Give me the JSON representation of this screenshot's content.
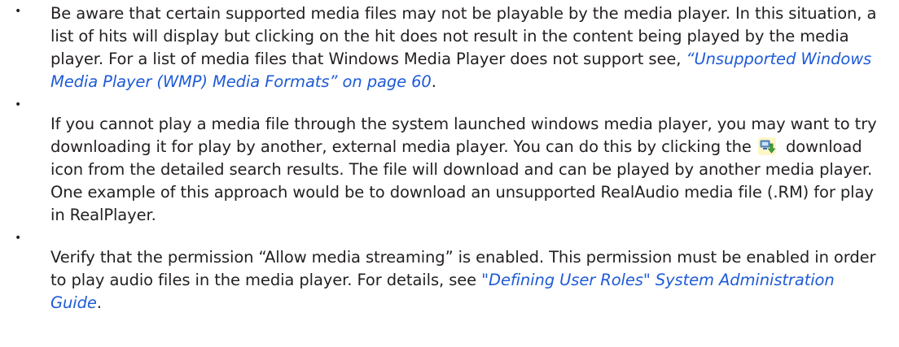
{
  "bullets": [
    {
      "marker": "•",
      "text_before": "Be aware that certain supported media files may not be playable by the media player. In this situation, a list of hits will display but clicking on the hit does not result in the content being played by the media player. For a list of media files that Windows Media Player does not support see, ",
      "link": "“Unsupported Windows Media Player (WMP) Media Formats” on page 60",
      "text_after": "."
    },
    {
      "marker": "•",
      "text_before": "If you cannot play a media file through the system launched windows media player, you may want to try downloading it for play by another, external media player. You can do this by clicking the ",
      "icon": "download-icon",
      "text_after": " download icon from the detailed search results. The file will download and can be played by another media player. One example of this approach would be to download an unsupported RealAudio media file (.RM) for play in RealPlayer."
    },
    {
      "marker": "•",
      "text_before": "Verify that the permission “Allow media streaming” is enabled. This permission must be enabled in order to play audio files in the media player. For details, see ",
      "link": "\"Defining User Roles\" System Administration Guide",
      "text_after": "."
    }
  ],
  "colors": {
    "text": "#231f20",
    "link": "#1f5bd6"
  }
}
